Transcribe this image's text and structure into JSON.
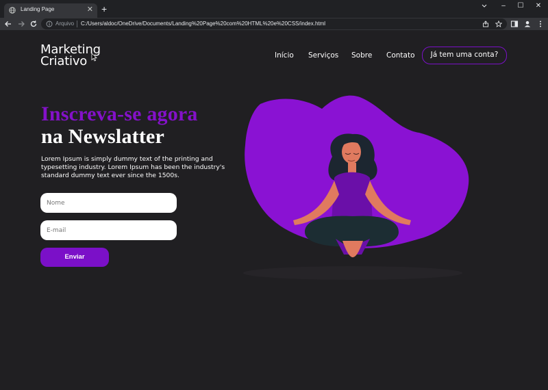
{
  "browser": {
    "tab_title": "Landing Page",
    "tab_close": "✕",
    "new_tab": "+",
    "address_prefix": "Arquivo",
    "url": "C:/Users/aldoc/OneDrive/Documents/Landing%20Page%20com%20HTML%20e%20CSS/index.html",
    "window_controls": {
      "minimize": "–",
      "maximize": "☐",
      "close": "✕"
    }
  },
  "header": {
    "logo_line1": "Marketing",
    "logo_line2": "Criativo",
    "nav": [
      "Início",
      "Serviços",
      "Sobre",
      "Contato"
    ],
    "account_button": "Já tem uma conta?"
  },
  "hero": {
    "title_line1": "Inscreva-se agora",
    "title_line2": "na Newslatter",
    "description": "Lorem Ipsum is simply dummy text of the printing and typesetting industry. Lorem Ipsum has been the industry's standard dummy text ever since the 1500s.",
    "form": {
      "name_placeholder": "Nome",
      "email_placeholder": "E-mail",
      "submit_label": "Enviar"
    }
  },
  "colors": {
    "accent": "#7b10c8",
    "title_purple": "#8411c9",
    "page_background": "#201f22",
    "blob": "#8a12d3"
  },
  "icons": [
    "globe-icon",
    "close-icon",
    "plus-icon",
    "back-arrow-icon",
    "forward-arrow-icon",
    "reload-icon",
    "info-icon",
    "share-icon",
    "star-icon",
    "sidebar-icon",
    "profile-icon",
    "menu-icon",
    "chevron-down-icon"
  ]
}
